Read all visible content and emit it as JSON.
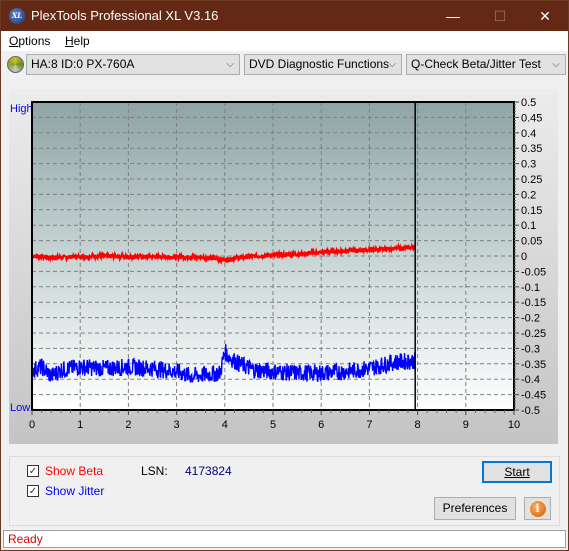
{
  "window": {
    "title": "PlexTools Professional XL V3.16",
    "logo_text": "XL",
    "minimize": "—",
    "maximize": "☐",
    "close": "✕"
  },
  "menu": [
    {
      "label": "Options",
      "mnemonic": "O",
      "rest": "ptions"
    },
    {
      "label": "Help",
      "mnemonic": "H",
      "rest": "elp"
    }
  ],
  "toolbar": {
    "drive": "HA:8 ID:0  PX-760A",
    "function": "DVD Diagnostic Functions",
    "test": "Q-Check Beta/Jitter Test",
    "chevron": "⌵"
  },
  "chart_data": {
    "type": "line",
    "title": "",
    "xlabel": "",
    "ylabel": "",
    "left_axis_labels": {
      "top": "High",
      "bottom": "Low"
    },
    "xlim": [
      0,
      10
    ],
    "ylim": [
      -0.5,
      0.5
    ],
    "x_ticks": [
      "0",
      "1",
      "2",
      "3",
      "4",
      "5",
      "6",
      "7",
      "8",
      "9",
      "10"
    ],
    "y_ticks": [
      "0.5",
      "0.45",
      "0.4",
      "0.35",
      "0.3",
      "0.25",
      "0.2",
      "0.15",
      "0.1",
      "0.05",
      "0",
      "-0.05",
      "-0.1",
      "-0.15",
      "-0.2",
      "-0.25",
      "-0.3",
      "-0.35",
      "-0.4",
      "-0.45",
      "-0.5"
    ],
    "grid": true,
    "end_marker_x": 7.95,
    "series": [
      {
        "name": "Beta",
        "color": "#ff0000",
        "x": [
          0,
          0.5,
          1,
          1.5,
          2,
          2.5,
          3,
          3.5,
          3.9,
          4.0,
          4.5,
          5,
          5.5,
          6,
          6.5,
          7,
          7.5,
          7.95
        ],
        "y": [
          0.0,
          -0.005,
          -0.002,
          0.0,
          -0.002,
          -0.002,
          -0.003,
          -0.004,
          -0.01,
          -0.012,
          -0.002,
          0.003,
          0.006,
          0.012,
          0.017,
          0.02,
          0.024,
          0.028
        ]
      },
      {
        "name": "Jitter",
        "color": "#0000ff",
        "x": [
          0,
          0.2,
          0.4,
          0.6,
          1,
          1.5,
          2,
          2.5,
          3,
          3.3,
          3.6,
          3.9,
          4.0,
          4.1,
          4.3,
          4.6,
          5,
          5.5,
          6,
          6.5,
          7,
          7.5,
          7.95
        ],
        "y": [
          -0.37,
          -0.36,
          -0.39,
          -0.37,
          -0.36,
          -0.365,
          -0.36,
          -0.365,
          -0.375,
          -0.39,
          -0.385,
          -0.38,
          -0.31,
          -0.33,
          -0.35,
          -0.37,
          -0.375,
          -0.38,
          -0.38,
          -0.375,
          -0.365,
          -0.345,
          -0.34
        ]
      }
    ]
  },
  "controls": {
    "show_beta": {
      "label": "Show Beta",
      "mnemonic": "B",
      "checked": true,
      "color": "#ff0000"
    },
    "show_jitter": {
      "label": "Show Jitter",
      "mnemonic": "J",
      "checked": true,
      "color": "#0000ff"
    },
    "lsn_label": "LSN:",
    "lsn_value": "4173824",
    "start_button": "Start",
    "preferences_button": "Preferences",
    "info_icon": "i"
  },
  "status": "Ready"
}
